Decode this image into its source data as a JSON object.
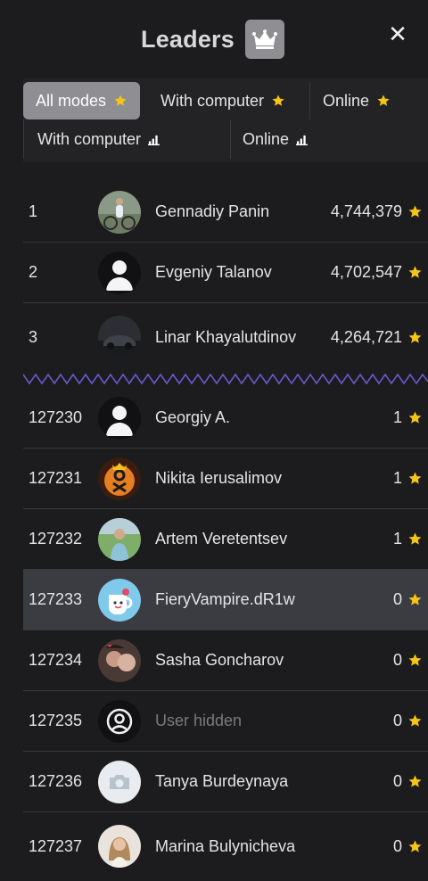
{
  "header": {
    "title": "Leaders",
    "crown_icon": "crown-icon",
    "close_label": "✕"
  },
  "tabs": [
    {
      "label": "All modes",
      "icon": "star-icon",
      "active": true
    },
    {
      "label": "With computer",
      "icon": "star-icon",
      "active": false
    },
    {
      "label": "Online",
      "icon": "star-icon",
      "active": false
    },
    {
      "label": "With computer",
      "icon": "bar-chart-icon",
      "active": false
    },
    {
      "label": "Online",
      "icon": "bar-chart-icon",
      "active": false
    }
  ],
  "top_leaders": [
    {
      "rank": "1",
      "name": "Gennadiy Panin",
      "score": "4,744,379",
      "avatar": "photo-cyclist"
    },
    {
      "rank": "2",
      "name": "Evgeniy Talanov",
      "score": "4,702,547",
      "avatar": "silhouette"
    },
    {
      "rank": "3",
      "name": "Linar Khayalutdinov",
      "score": "4,264,721",
      "avatar": "photo-car"
    }
  ],
  "nearby": [
    {
      "rank": "127230",
      "name": "Georgiy A.",
      "score": "1",
      "avatar": "silhouette"
    },
    {
      "rank": "127231",
      "name": "Nikita Ierusalimov",
      "score": "1",
      "avatar": "ok-logo"
    },
    {
      "rank": "127232",
      "name": "Artem Veretentsev",
      "score": "1",
      "avatar": "photo-field"
    },
    {
      "rank": "127233",
      "name": "FieryVampire.dR1w",
      "score": "0",
      "avatar": "cartoon",
      "highlight": true
    },
    {
      "rank": "127234",
      "name": "Sasha Goncharov",
      "score": "0",
      "avatar": "photo-couple"
    },
    {
      "rank": "127235",
      "name": "User hidden",
      "score": "0",
      "avatar": "user-hidden",
      "muted": true
    },
    {
      "rank": "127236",
      "name": "Tanya Burdeynaya",
      "score": "0",
      "avatar": "camera-placeholder"
    },
    {
      "rank": "127237",
      "name": "Marina Bulynicheva",
      "score": "0",
      "avatar": "photo-woman"
    }
  ],
  "colors": {
    "background": "#1c1c1e",
    "star": "#f5c518",
    "active_tab": "#8e8e93",
    "separator_wave": "#6a5acd",
    "highlight_row": "#3a3c42"
  }
}
